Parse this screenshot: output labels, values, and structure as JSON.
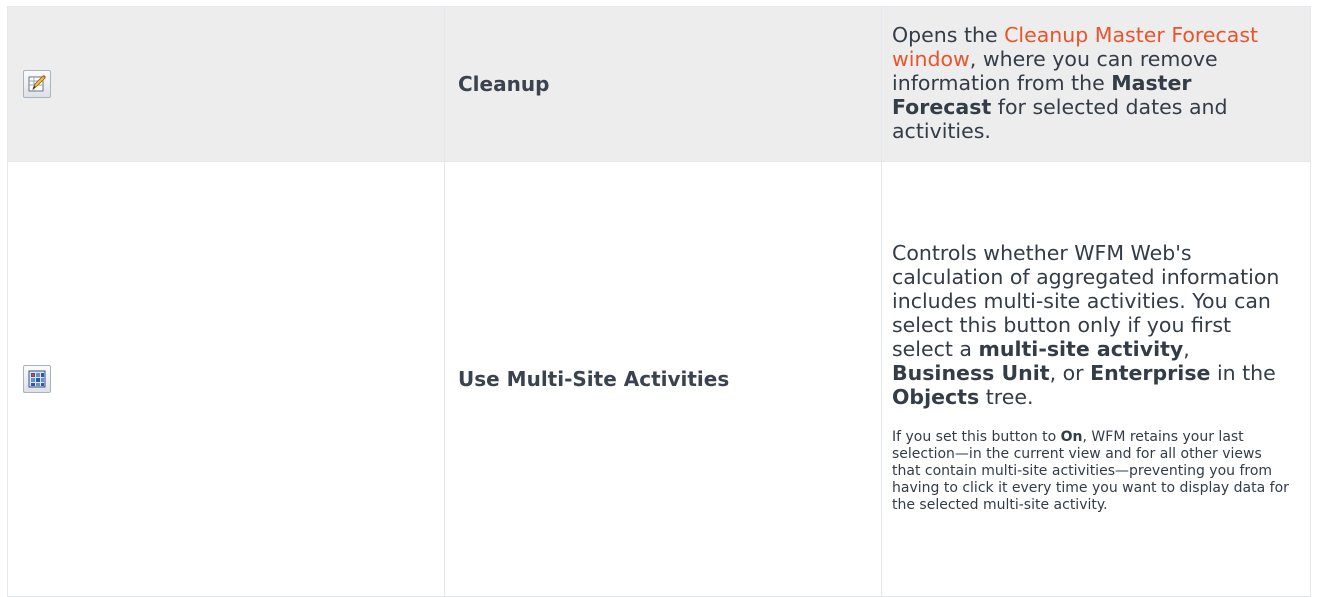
{
  "rows": [
    {
      "icon": "cleanup-pencil-icon",
      "name": "Cleanup",
      "desc": {
        "p1": "Opens the ",
        "link": "Cleanup Master Forecast window",
        "p2": ", where you can remove information from the ",
        "b1": "Master Forecast",
        "p3": " for selected dates and activities."
      }
    },
    {
      "icon": "multi-site-grid-icon",
      "name": "Use Multi-Site Activities",
      "desc": {
        "p1": "Controls whether WFM Web's calculation of aggregated information includes multi-site activities. You can select this button only if you first select a ",
        "b1": "multi-site activity",
        "p2": ", ",
        "b2": "Business Unit",
        "p3": ", or ",
        "b3": "Enterprise",
        "p4": " in the ",
        "b4": "Objects",
        "p5": " tree."
      },
      "note": {
        "p1": "If you set this button to ",
        "b1": "On",
        "p2": ", WFM retains your last selection—in the current view and for all other views that contain multi-site activities—preventing you from having to click it every time you want to display data for the selected multi-site activity."
      }
    }
  ],
  "colors": {
    "link": "#e8552c",
    "text": "#333c47",
    "row_shade": "#ededed"
  }
}
